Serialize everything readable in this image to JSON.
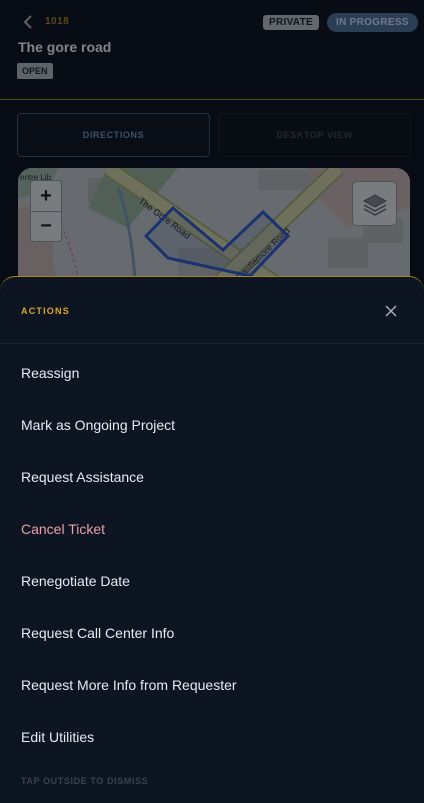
{
  "header": {
    "ticket_number": "1018",
    "title": "The gore road",
    "badges": {
      "private": "PRIVATE",
      "status": "IN PROGRESS",
      "open": "OPEN"
    }
  },
  "tabs": [
    {
      "label": "DIRECTIONS",
      "active": true
    },
    {
      "label": "DESKTOP VIEW",
      "active": false
    }
  ],
  "map": {
    "street_labels": [
      "The Gore Road",
      "Castlemore Road"
    ],
    "corner_text": "entre Lib",
    "zoom_in": "+",
    "zoom_out": "−",
    "layers_icon": "layers-icon"
  },
  "sheet": {
    "title": "ACTIONS",
    "actions": [
      "Reassign",
      "Mark as Ongoing Project",
      "Request Assistance",
      "Cancel Ticket",
      "Renegotiate Date",
      "Request Call Center Info",
      "Request More Info from Requester",
      "Edit Utilities"
    ],
    "hint": "TAP OUTSIDE TO DISMISS"
  },
  "colors": {
    "accent": "#d9a824",
    "danger": "#eaa0a5",
    "status_badge": "#4c6a90",
    "background": "#0a0e17"
  }
}
